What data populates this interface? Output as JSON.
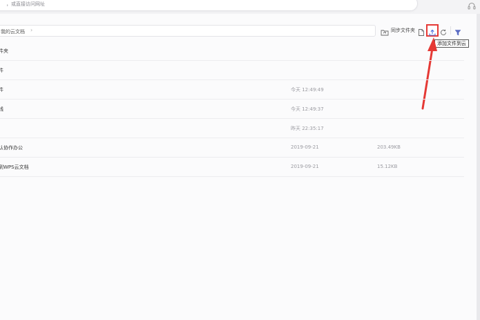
{
  "search": {
    "placeholder": "，或直接访问网址"
  },
  "icons": {
    "headset": "headset-icon",
    "folder_sync": "folder-sync-icon",
    "new_file": "new-file-icon",
    "upload": "upload-icon",
    "refresh": "refresh-icon",
    "filter": "filter-icon"
  },
  "breadcrumb": {
    "label": "我的云文档",
    "separator": "›"
  },
  "toolbar": {
    "sync_label": "同步文件夹",
    "upload_tooltip": "添加文件到云"
  },
  "colors": {
    "highlight": "#e53935",
    "accent": "#4a6ee0"
  },
  "files": [
    {
      "name": "件夹",
      "time": "",
      "size": ""
    },
    {
      "name": "件",
      "time": "",
      "size": ""
    },
    {
      "name": "件",
      "time": "今天 12:49:49",
      "size": ""
    },
    {
      "name": "线",
      "time": "今天 12:49:37",
      "size": ""
    },
    {
      "name": "",
      "time": "昨天 22:35:17",
      "size": ""
    },
    {
      "name": "认协作办公",
      "time": "2019-09-21",
      "size": "203.49KB"
    },
    {
      "name": "到WPS云文档",
      "time": "2019-09-21",
      "size": "15.12KB"
    }
  ]
}
